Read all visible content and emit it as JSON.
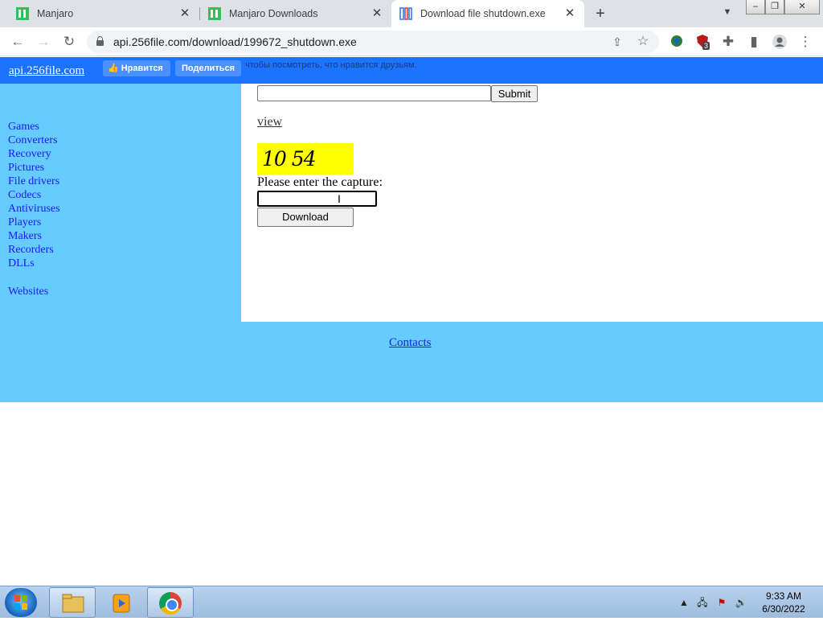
{
  "browser": {
    "tabs": [
      {
        "title": "Manjaro"
      },
      {
        "title": "Manjaro Downloads"
      },
      {
        "title": "Download file shutdown.exe"
      }
    ],
    "url": "api.256file.com/download/199672_shutdown.exe",
    "extension_badge": "3"
  },
  "fbbar": {
    "site_link": "api.256file.com",
    "like_label": "Нравится",
    "share_label": "Поделиться",
    "prompt_text": "чтобы посмотреть, что нравится друзьям."
  },
  "sidebar": {
    "items": [
      {
        "label": "Games"
      },
      {
        "label": "Converters"
      },
      {
        "label": "Recovery"
      },
      {
        "label": "Pictures"
      },
      {
        "label": "File drivers"
      },
      {
        "label": "Codecs"
      },
      {
        "label": "Antiviruses"
      },
      {
        "label": "Players"
      },
      {
        "label": "Makers"
      },
      {
        "label": "Recorders"
      },
      {
        "label": "DLLs"
      }
    ],
    "websites_label": "Websites"
  },
  "main": {
    "submit_label": "Submit",
    "view_label": "view",
    "captcha_text": "10 54",
    "captcha_prompt": "Please enter the capture:",
    "download_label": "Download"
  },
  "footer": {
    "contacts_label": "Contacts"
  },
  "taskbar": {
    "time": "9:33 AM",
    "date": "6/30/2022"
  }
}
